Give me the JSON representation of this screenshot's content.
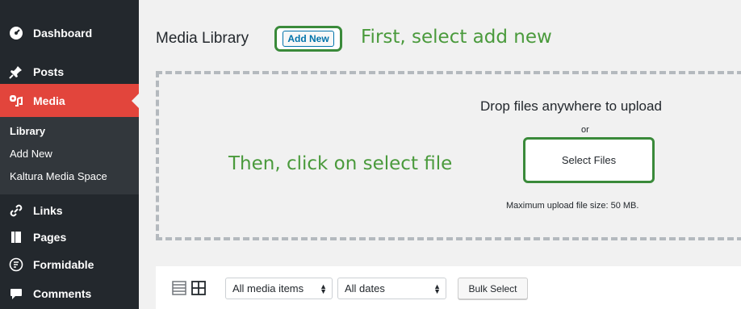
{
  "sidebar": {
    "items": [
      {
        "label": "Dashboard",
        "icon": "dashboard-icon"
      },
      {
        "label": "Posts",
        "icon": "pin-icon"
      },
      {
        "label": "Media",
        "icon": "media-icon"
      },
      {
        "label": "Links",
        "icon": "link-icon"
      },
      {
        "label": "Pages",
        "icon": "pages-icon"
      },
      {
        "label": "Formidable",
        "icon": "formidable-icon"
      },
      {
        "label": "Comments",
        "icon": "comment-icon"
      }
    ],
    "submenu": [
      "Library",
      "Add New",
      "Kaltura Media Space"
    ]
  },
  "header": {
    "title": "Media Library",
    "add_new_label": "Add New"
  },
  "annotations": {
    "first": "First, select add new",
    "then": "Then, click on select file"
  },
  "upload": {
    "drop_title": "Drop files anywhere to upload",
    "or_text": "or",
    "select_files_label": "Select Files",
    "max_size": "Maximum upload file size: 50 MB."
  },
  "toolbar": {
    "filter_type": "All media items",
    "filter_date": "All dates",
    "bulk_select_label": "Bulk Select"
  },
  "colors": {
    "sidebar_bg": "#23282d",
    "active_bg": "#e2453c",
    "annotation_green": "#4a9a3c"
  }
}
